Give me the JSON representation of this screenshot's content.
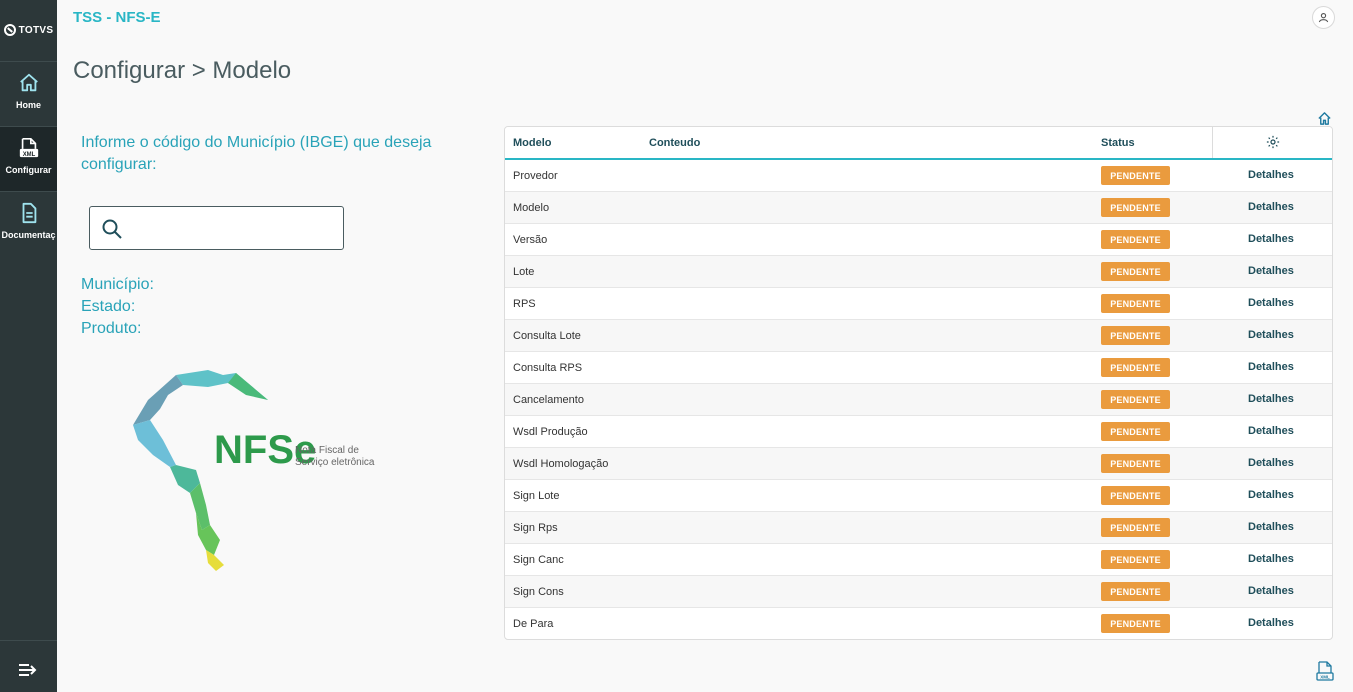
{
  "app": {
    "logo_text": "TOTVS",
    "title": "TSS - NFS-E"
  },
  "sidebar": {
    "items": [
      {
        "label": "Home",
        "icon": "home-icon"
      },
      {
        "label": "Configurar",
        "icon": "xml-file-icon"
      },
      {
        "label": "Documentaç",
        "icon": "document-icon"
      }
    ],
    "collapse_icon": "collapse-menu-icon"
  },
  "header": {
    "user_icon": "user-icon"
  },
  "page": {
    "title": "Configurar > Modelo"
  },
  "left": {
    "prompt": "Informe o código do Município (IBGE) que deseja configurar:",
    "search": {
      "value": "",
      "placeholder": "",
      "icon": "search-icon"
    },
    "municipio_label": "Município:",
    "estado_label": "Estado:",
    "produto_label": "Produto:",
    "logo": {
      "wordmark": "NFSe",
      "line1": "Nota Fiscal de",
      "line2": "Serviço eletrônica"
    }
  },
  "table": {
    "columns": {
      "modelo": "Modelo",
      "conteudo": "Conteudo",
      "status": "Status",
      "settings_icon": "gear-icon"
    },
    "rows": [
      {
        "modelo": "Provedor",
        "conteudo": "",
        "status": "PENDENTE",
        "action": "Detalhes"
      },
      {
        "modelo": "Modelo",
        "conteudo": "",
        "status": "PENDENTE",
        "action": "Detalhes"
      },
      {
        "modelo": "Versão",
        "conteudo": "",
        "status": "PENDENTE",
        "action": "Detalhes"
      },
      {
        "modelo": "Lote",
        "conteudo": "",
        "status": "PENDENTE",
        "action": "Detalhes"
      },
      {
        "modelo": "RPS",
        "conteudo": "",
        "status": "PENDENTE",
        "action": "Detalhes"
      },
      {
        "modelo": "Consulta Lote",
        "conteudo": "",
        "status": "PENDENTE",
        "action": "Detalhes"
      },
      {
        "modelo": "Consulta RPS",
        "conteudo": "",
        "status": "PENDENTE",
        "action": "Detalhes"
      },
      {
        "modelo": "Cancelamento",
        "conteudo": "",
        "status": "PENDENTE",
        "action": "Detalhes"
      },
      {
        "modelo": "Wsdl Produção",
        "conteudo": "",
        "status": "PENDENTE",
        "action": "Detalhes"
      },
      {
        "modelo": "Wsdl Homologação",
        "conteudo": "",
        "status": "PENDENTE",
        "action": "Detalhes"
      },
      {
        "modelo": "Sign Lote",
        "conteudo": "",
        "status": "PENDENTE",
        "action": "Detalhes"
      },
      {
        "modelo": "Sign Rps",
        "conteudo": "",
        "status": "PENDENTE",
        "action": "Detalhes"
      },
      {
        "modelo": "Sign Canc",
        "conteudo": "",
        "status": "PENDENTE",
        "action": "Detalhes"
      },
      {
        "modelo": "Sign Cons",
        "conteudo": "",
        "status": "PENDENTE",
        "action": "Detalhes"
      },
      {
        "modelo": "De Para",
        "conteudo": "",
        "status": "PENDENTE",
        "action": "Detalhes"
      }
    ]
  },
  "colors": {
    "sidebar": "#2c3739",
    "accent": "#29b6c5",
    "pending_badge": "#ea9b3e",
    "header_text": "#1f4e5a"
  }
}
